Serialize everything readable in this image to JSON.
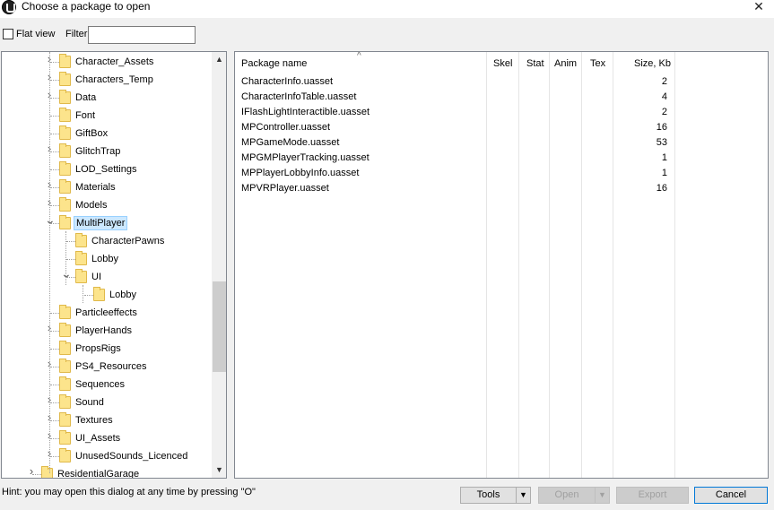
{
  "window": {
    "title": "Choose a package to open",
    "close_glyph": "✕"
  },
  "toolbar": {
    "flat_view_label": "Flat view",
    "flat_view_checked": false,
    "filter_label": "Filter:",
    "filter_value": ""
  },
  "tree": {
    "items": [
      {
        "label": "Character_Assets",
        "expandable": true
      },
      {
        "label": "Characters_Temp",
        "expandable": true
      },
      {
        "label": "Data",
        "expandable": true
      },
      {
        "label": "Font",
        "expandable": false
      },
      {
        "label": "GiftBox",
        "expandable": false
      },
      {
        "label": "GlitchTrap",
        "expandable": true
      },
      {
        "label": "LOD_Settings",
        "expandable": false
      },
      {
        "label": "Materials",
        "expandable": true
      },
      {
        "label": "Models",
        "expandable": true
      },
      {
        "label": "MultiPlayer",
        "expandable": true,
        "expanded": true,
        "selected": true
      },
      {
        "label": "CharacterPawns",
        "expandable": false
      },
      {
        "label": "Lobby",
        "expandable": false
      },
      {
        "label": "UI",
        "expandable": true,
        "expanded": true
      },
      {
        "label": "Lobby",
        "expandable": false
      },
      {
        "label": "Particleeffects",
        "expandable": false
      },
      {
        "label": "PlayerHands",
        "expandable": true
      },
      {
        "label": "PropsRigs",
        "expandable": false
      },
      {
        "label": "PS4_Resources",
        "expandable": true
      },
      {
        "label": "Sequences",
        "expandable": false
      },
      {
        "label": "Sound",
        "expandable": true
      },
      {
        "label": "Textures",
        "expandable": true
      },
      {
        "label": "UI_Assets",
        "expandable": true
      },
      {
        "label": "UnusedSounds_Licenced",
        "expandable": true
      },
      {
        "label": "ResidentialGarage",
        "expandable": true
      }
    ]
  },
  "list": {
    "columns": [
      "Package name",
      "Skel",
      "Stat",
      "Anim",
      "Tex",
      "Size, Kb"
    ],
    "rows": [
      {
        "name": "CharacterInfo.uasset",
        "size": "2"
      },
      {
        "name": "CharacterInfoTable.uasset",
        "size": "4"
      },
      {
        "name": "IFlashLightInteractible.uasset",
        "size": "2"
      },
      {
        "name": "MPController.uasset",
        "size": "16"
      },
      {
        "name": "MPGameMode.uasset",
        "size": "53"
      },
      {
        "name": "MPGMPlayerTracking.uasset",
        "size": "1"
      },
      {
        "name": "MPPlayerLobbyInfo.uasset",
        "size": "1"
      },
      {
        "name": "MPVRPlayer.uasset",
        "size": "16"
      }
    ]
  },
  "footer": {
    "hint": "Hint: you may open this dialog at any time by pressing \"O\"",
    "tools_label": "Tools",
    "open_label": "Open",
    "export_label": "Export",
    "cancel_label": "Cancel"
  }
}
